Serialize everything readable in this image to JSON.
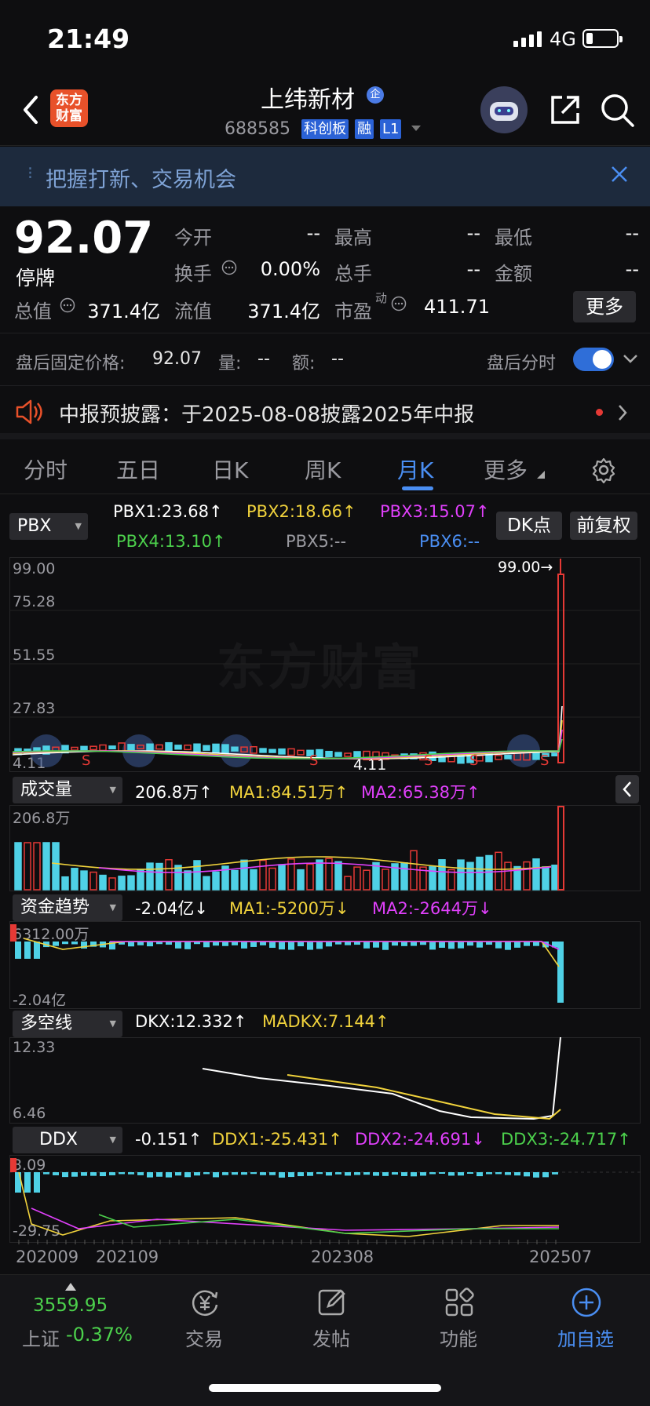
{
  "status_bar": {
    "time": "21:49",
    "network": "4G"
  },
  "header": {
    "logo_text_1": "东方",
    "logo_text_2": "财富",
    "stock_name": "上纬新材",
    "badge": "企",
    "stock_code": "688585",
    "tags": [
      "科创板",
      "融",
      "L1"
    ]
  },
  "banner": {
    "text": "把握打新、交易机会"
  },
  "quote": {
    "price": "92.07",
    "status": "停牌",
    "open_label": "今开",
    "open_value": "--",
    "high_label": "最高",
    "high_value": "--",
    "low_label": "最低",
    "low_value": "--",
    "turnover_label": "换手",
    "turnover_value": "0.00%",
    "total_hands_label": "总手",
    "total_hands_value": "--",
    "amount_label": "金额",
    "amount_value": "--",
    "market_cap_label": "总值",
    "market_cap_value": "371.4亿",
    "float_cap_label": "流值",
    "float_cap_value": "371.4亿",
    "pe_label": "市盈",
    "pe_sup": "动",
    "pe_value": "411.71",
    "more_label": "更多"
  },
  "after_hours": {
    "price_label": "盘后固定价格:",
    "price_value": "92.07",
    "volume_label": "量:",
    "volume_value": "--",
    "amount_label": "额:",
    "amount_value": "--",
    "toggle_label": "盘后分时",
    "toggle_on": true
  },
  "notice": {
    "text": "中报预披露：于2025-08-08披露2025年中报"
  },
  "tabs": [
    {
      "label": "分时"
    },
    {
      "label": "五日"
    },
    {
      "label": "日K"
    },
    {
      "label": "周K"
    },
    {
      "label": "月K",
      "active": true
    },
    {
      "label": "更多"
    }
  ],
  "main_chart": {
    "selector": "PBX",
    "indicators": [
      {
        "text": "PBX1:23.68↑",
        "color": "#ffffff"
      },
      {
        "text": "PBX2:18.66↑",
        "color": "#f0d23c"
      },
      {
        "text": "PBX3:15.07↑",
        "color": "#e040fb"
      },
      {
        "text": "PBX4:13.10↑",
        "color": "#4cd04c"
      },
      {
        "text": "PBX5:--",
        "color": "#9a9aa0"
      },
      {
        "text": "PBX6:--",
        "color": "#4a8ef2"
      }
    ],
    "dk_button": "DK点",
    "adjust_button": "前复权",
    "y_labels": [
      "99.00",
      "75.28",
      "51.55",
      "27.83",
      "4.11"
    ],
    "max_marker": "99.00→",
    "min_marker": "4.11",
    "watermark": "东方财富"
  },
  "volume_panel": {
    "selector": "成交量",
    "indicators": [
      {
        "text": "206.8万↑",
        "color": "#ffffff"
      },
      {
        "text": "MA1:84.51万↑",
        "color": "#f0d23c"
      },
      {
        "text": "MA2:65.38万↑",
        "color": "#e040fb"
      }
    ],
    "y_top": "206.8万"
  },
  "fund_panel": {
    "selector": "资金趋势",
    "indicators": [
      {
        "text": "-2.04亿↓",
        "color": "#ffffff"
      },
      {
        "text": "MA1:-5200万↓",
        "color": "#f0d23c"
      },
      {
        "text": "MA2:-2644万↓",
        "color": "#e040fb"
      }
    ],
    "y_top": "6312.00万",
    "y_bottom": "-2.04亿"
  },
  "dkx_panel": {
    "selector": "多空线",
    "indicators": [
      {
        "text": "DKX:12.332↑",
        "color": "#ffffff"
      },
      {
        "text": "MADKX:7.144↑",
        "color": "#f0d23c"
      }
    ],
    "y_top": "12.33",
    "y_bottom": "6.46"
  },
  "ddx_panel": {
    "selector": "DDX",
    "indicators": [
      {
        "text": "-0.151↑",
        "color": "#ffffff"
      },
      {
        "text": "DDX1:-25.431↑",
        "color": "#f0d23c"
      },
      {
        "text": "DDX2:-24.691↓",
        "color": "#e040fb"
      },
      {
        "text": "DDX3:-24.717↑",
        "color": "#4cd04c"
      }
    ],
    "y_top": "3.09",
    "y_bottom": "-29.75"
  },
  "x_axis": [
    "202009",
    "202109",
    "202308",
    "202507"
  ],
  "bottom_nav": {
    "index_value": "3559.95",
    "index_name": "上证",
    "index_change": "-0.37%",
    "items": [
      {
        "label": "交易"
      },
      {
        "label": "发帖"
      },
      {
        "label": "功能"
      },
      {
        "label": "加自选",
        "active": true
      }
    ]
  },
  "colors": {
    "accent": "#4a8ef2",
    "up": "#e53935",
    "down": "#4fd1e6",
    "yellow": "#f0d23c",
    "magenta": "#e040fb",
    "green": "#4cd04c"
  }
}
